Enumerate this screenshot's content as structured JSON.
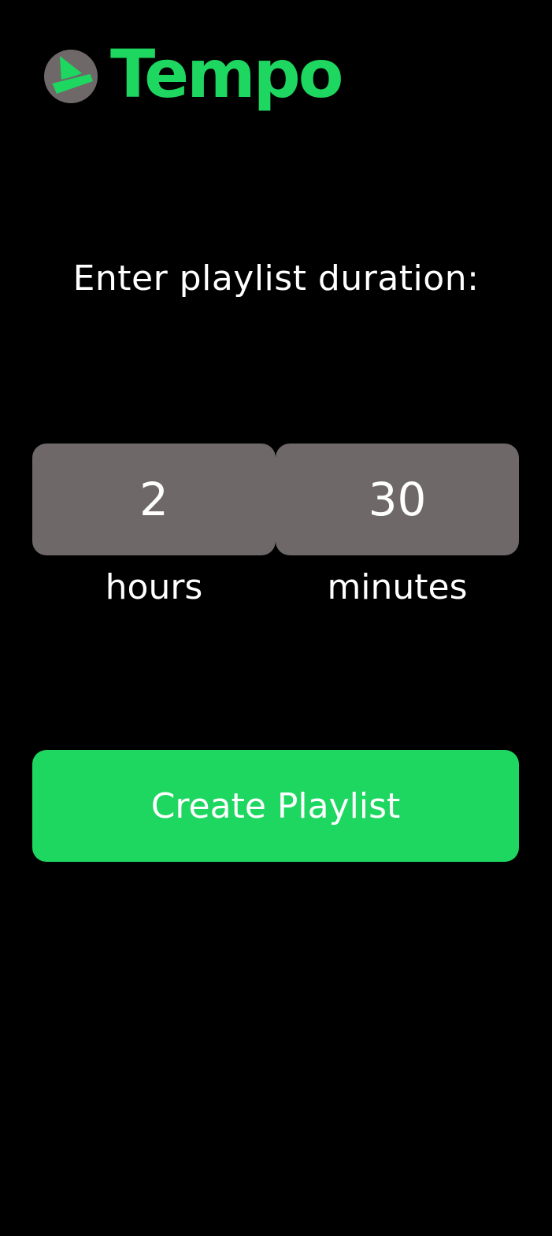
{
  "app": {
    "brand_name": "Tempo",
    "logo_icon": "play-triangle-logo-icon",
    "brand_color": "#1ed760",
    "logo_bg_color": "#6e6868"
  },
  "main": {
    "prompt": "Enter playlist duration:",
    "hours": {
      "value": "2",
      "label": "hours"
    },
    "minutes": {
      "value": "30",
      "label": "minutes"
    },
    "field_color": "#6e6868",
    "create_button_label": "Create Playlist",
    "button_color": "#1ed760"
  }
}
